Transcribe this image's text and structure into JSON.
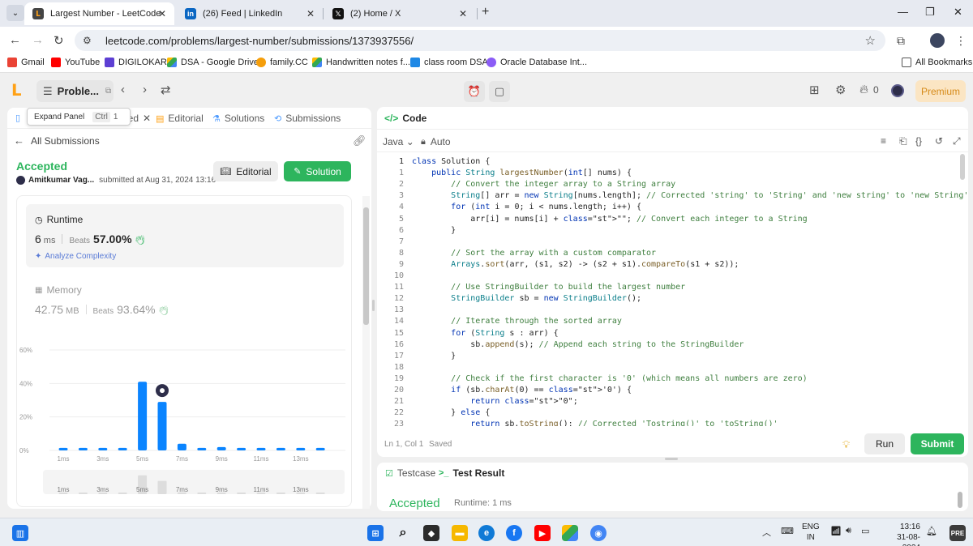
{
  "browser": {
    "tabs": [
      {
        "title": "Largest Number - LeetCode",
        "active": true
      },
      {
        "title": "(26) Feed | LinkedIn",
        "active": false
      },
      {
        "title": "(2) Home / X",
        "active": false
      }
    ],
    "url": "leetcode.com/problems/largest-number/submissions/1373937556/",
    "bookmarks": [
      "Gmail",
      "YouTube",
      "DIGILOKAR",
      "DSA - Google Drive",
      "family.CC",
      "Handwritten notes f...",
      "class room DSA",
      "Oracle Database Int...",
      "All Bookmarks"
    ]
  },
  "lc_header": {
    "problem_button": "Proble...",
    "premium": "Premium",
    "streak": "0"
  },
  "left_tabs": {
    "tooltip": "Expand Panel",
    "tooltip_shortcut": "Ctrl",
    "tooltip_shortcut_2": "1",
    "accepted": "Accepted",
    "editorial": "Editorial",
    "solutions": "Solutions",
    "submissions": "Submissions"
  },
  "submission": {
    "back_label": "All Submissions",
    "status": "Accepted",
    "author": "Amitkumar Vag...",
    "submitted_at": "submitted at Aug 31, 2024 13:16",
    "editorial_btn": "Editorial",
    "solution_btn": "Solution",
    "runtime_label": "Runtime",
    "runtime_value": "6",
    "runtime_unit": "ms",
    "beats_label": "Beats",
    "runtime_beats": "57.00%",
    "analyze": "Analyze Complexity",
    "memory_label": "Memory",
    "memory_value": "42.75",
    "memory_unit": "MB",
    "memory_beats": "93.64%"
  },
  "chart_data": {
    "type": "bar",
    "y_ticks": [
      "60%",
      "40%",
      "20%",
      "0%"
    ],
    "ylim": [
      0,
      60
    ],
    "x_ticks": [
      "1ms",
      "3ms",
      "5ms",
      "7ms",
      "9ms",
      "11ms",
      "13ms"
    ],
    "categories": [
      "1ms",
      "2ms",
      "3ms",
      "4ms",
      "5ms",
      "6ms",
      "7ms",
      "8ms",
      "9ms",
      "10ms",
      "11ms",
      "12ms",
      "13ms",
      "14ms"
    ],
    "values": [
      1.5,
      1.5,
      1.5,
      1.5,
      41,
      29,
      4,
      1.5,
      2,
      1.5,
      1.5,
      1.5,
      1.5,
      1.5
    ],
    "highlight_index": 5,
    "bar_color": "#0a84ff",
    "mini_x_ticks": [
      "1ms",
      "3ms",
      "5ms",
      "7ms",
      "9ms",
      "11ms",
      "13ms"
    ]
  },
  "code": {
    "title": "Code",
    "language": "Java",
    "auto": "Auto",
    "cursor": "Ln 1, Col 1",
    "saved": "Saved",
    "run": "Run",
    "submit": "Submit",
    "line_numbers": [
      "1",
      "1",
      "2",
      "3",
      "4",
      "5",
      "6",
      "7",
      "8",
      "9",
      "10",
      "11",
      "12",
      "13",
      "14",
      "15",
      "16",
      "17",
      "18",
      "19",
      "20",
      "21",
      "22",
      "23"
    ],
    "lines": [
      "class Solution {",
      "    public String largestNumber(int[] nums) {",
      "        // Convert the integer array to a String array",
      "        String[] arr = new String[nums.length]; // Corrected 'string' to 'String' and 'new string' to 'new String'",
      "        for (int i = 0; i < nums.length; i++) {",
      "            arr[i] = nums[i] + \"\"; // Convert each integer to a String",
      "        }",
      "",
      "        // Sort the array with a custom comparator",
      "        Arrays.sort(arr, (s1, s2) -> (s2 + s1).compareTo(s1 + s2));",
      "",
      "        // Use StringBuilder to build the largest number",
      "        StringBuilder sb = new StringBuilder();",
      "",
      "        // Iterate through the sorted array",
      "        for (String s : arr) {",
      "            sb.append(s); // Append each string to the StringBuilder",
      "        }",
      "",
      "        // Check if the first character is '0' (which means all numbers are zero)",
      "        if (sb.charAt(0) == '0') {",
      "            return \"0\";",
      "        } else {",
      "            return sb.toString(); // Corrected 'Tostring()' to 'toString()'"
    ]
  },
  "result": {
    "testcase_tab": "Testcase",
    "result_tab": "Test Result",
    "status": "Accepted",
    "runtime": "Runtime: 1 ms"
  },
  "taskbar": {
    "lang_line1": "ENG",
    "lang_line2": "IN",
    "time": "13:16",
    "date": "31-08-2024"
  }
}
